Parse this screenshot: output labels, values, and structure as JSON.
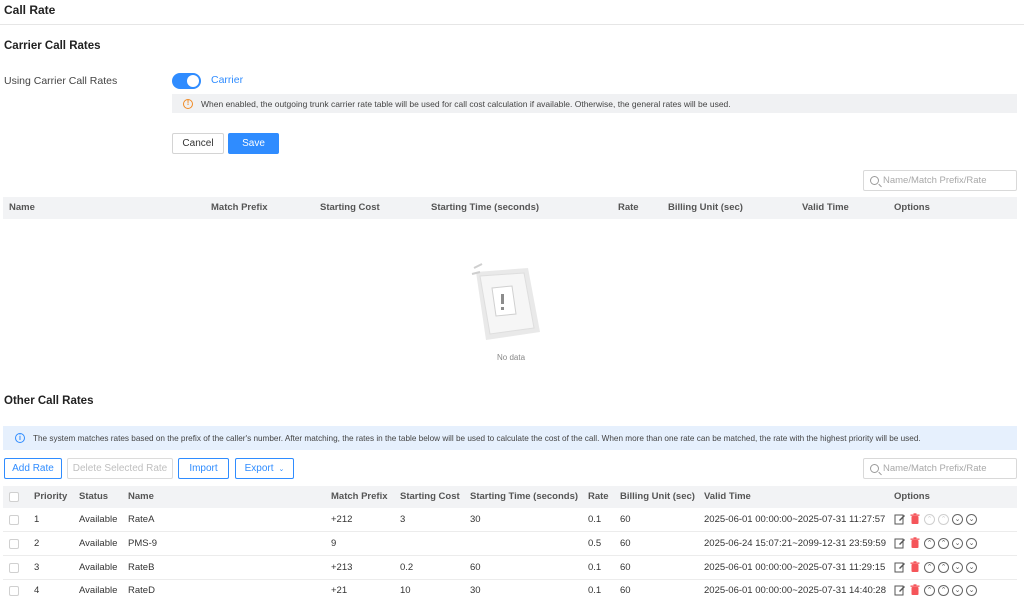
{
  "page_title": "Call Rate",
  "carrier": {
    "section_title": "Carrier Call Rates",
    "using_label": "Using Carrier Call Rates",
    "toggle_on": true,
    "toggle_label": "Carrier",
    "warning": "When enabled, the outgoing trunk carrier rate table will be used for call cost calculation if available. Otherwise, the general rates will be used.",
    "cancel_label": "Cancel",
    "save_label": "Save",
    "search_placeholder": "Name/Match Prefix/Rate",
    "columns": [
      "Name",
      "Match Prefix",
      "Starting Cost",
      "Starting Time (seconds)",
      "Rate",
      "Billing Unit (sec)",
      "Valid Time",
      "Options"
    ],
    "empty_text": "No data"
  },
  "other": {
    "section_title": "Other Call Rates",
    "info": "The system matches rates based on the prefix of the caller's number. After matching, the rates in the table below will be used to calculate the cost of the call. When more than one rate can be matched, the rate with the highest priority will be used.",
    "add_label": "Add Rate",
    "delete_label": "Delete Selected Rate",
    "import_label": "Import",
    "export_label": "Export",
    "search_placeholder": "Name/Match Prefix/Rate",
    "columns": [
      "Priority",
      "Status",
      "Name",
      "Match Prefix",
      "Starting Cost",
      "Starting Time (seconds)",
      "Rate",
      "Billing Unit (sec)",
      "Valid Time",
      "Options"
    ],
    "rows": [
      {
        "priority": "1",
        "status": "Available",
        "name": "RateA",
        "prefix": "+212",
        "cost": "3",
        "time": "30",
        "rate": "0.1",
        "unit": "60",
        "valid": "2025-06-01 00:00:00~2025-07-31 11:27:57"
      },
      {
        "priority": "2",
        "status": "Available",
        "name": "PMS-9",
        "prefix": "9",
        "cost": "",
        "time": "",
        "rate": "0.5",
        "unit": "60",
        "valid": "2025-06-24 15:07:21~2099-12-31 23:59:59"
      },
      {
        "priority": "3",
        "status": "Available",
        "name": "RateB",
        "prefix": "+213",
        "cost": "0.2",
        "time": "60",
        "rate": "0.1",
        "unit": "60",
        "valid": "2025-06-01 00:00:00~2025-07-31 11:29:15"
      },
      {
        "priority": "4",
        "status": "Available",
        "name": "RateD",
        "prefix": "+21",
        "cost": "10",
        "time": "30",
        "rate": "0.1",
        "unit": "60",
        "valid": "2025-06-01 00:00:00~2025-07-31 14:40:28"
      }
    ]
  },
  "colors": {
    "accent": "#2f8cff",
    "delete": "#f5555a",
    "warning": "#f08a24"
  }
}
